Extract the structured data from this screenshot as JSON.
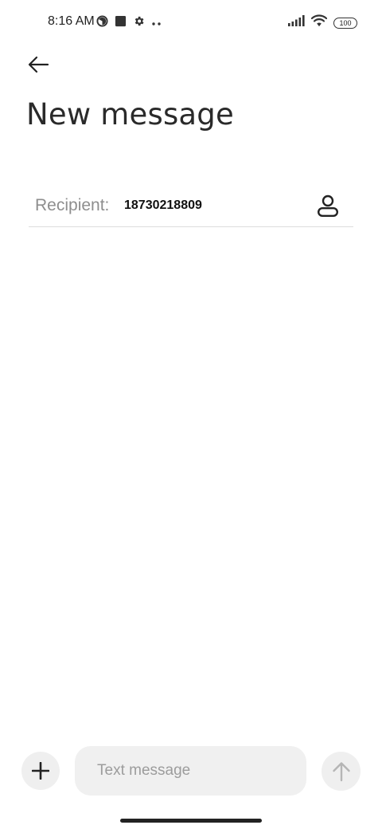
{
  "status_bar": {
    "time": "8:16 AM",
    "left_icons": [
      "data-saver-icon",
      "square-app-icon",
      "settings-gear-icon",
      "more-dots-icon"
    ],
    "right_icons": [
      "signal-icon",
      "wifi-icon",
      "battery-icon"
    ],
    "battery_level": "100"
  },
  "header": {
    "back_icon": "back-arrow-icon",
    "title": "New message"
  },
  "recipient": {
    "label": "Recipient:",
    "value": "18730218809",
    "contact_icon": "contact-person-icon"
  },
  "composer": {
    "attach_icon": "plus-icon",
    "placeholder": "Text message",
    "value": "",
    "send_icon": "arrow-up-icon"
  }
}
